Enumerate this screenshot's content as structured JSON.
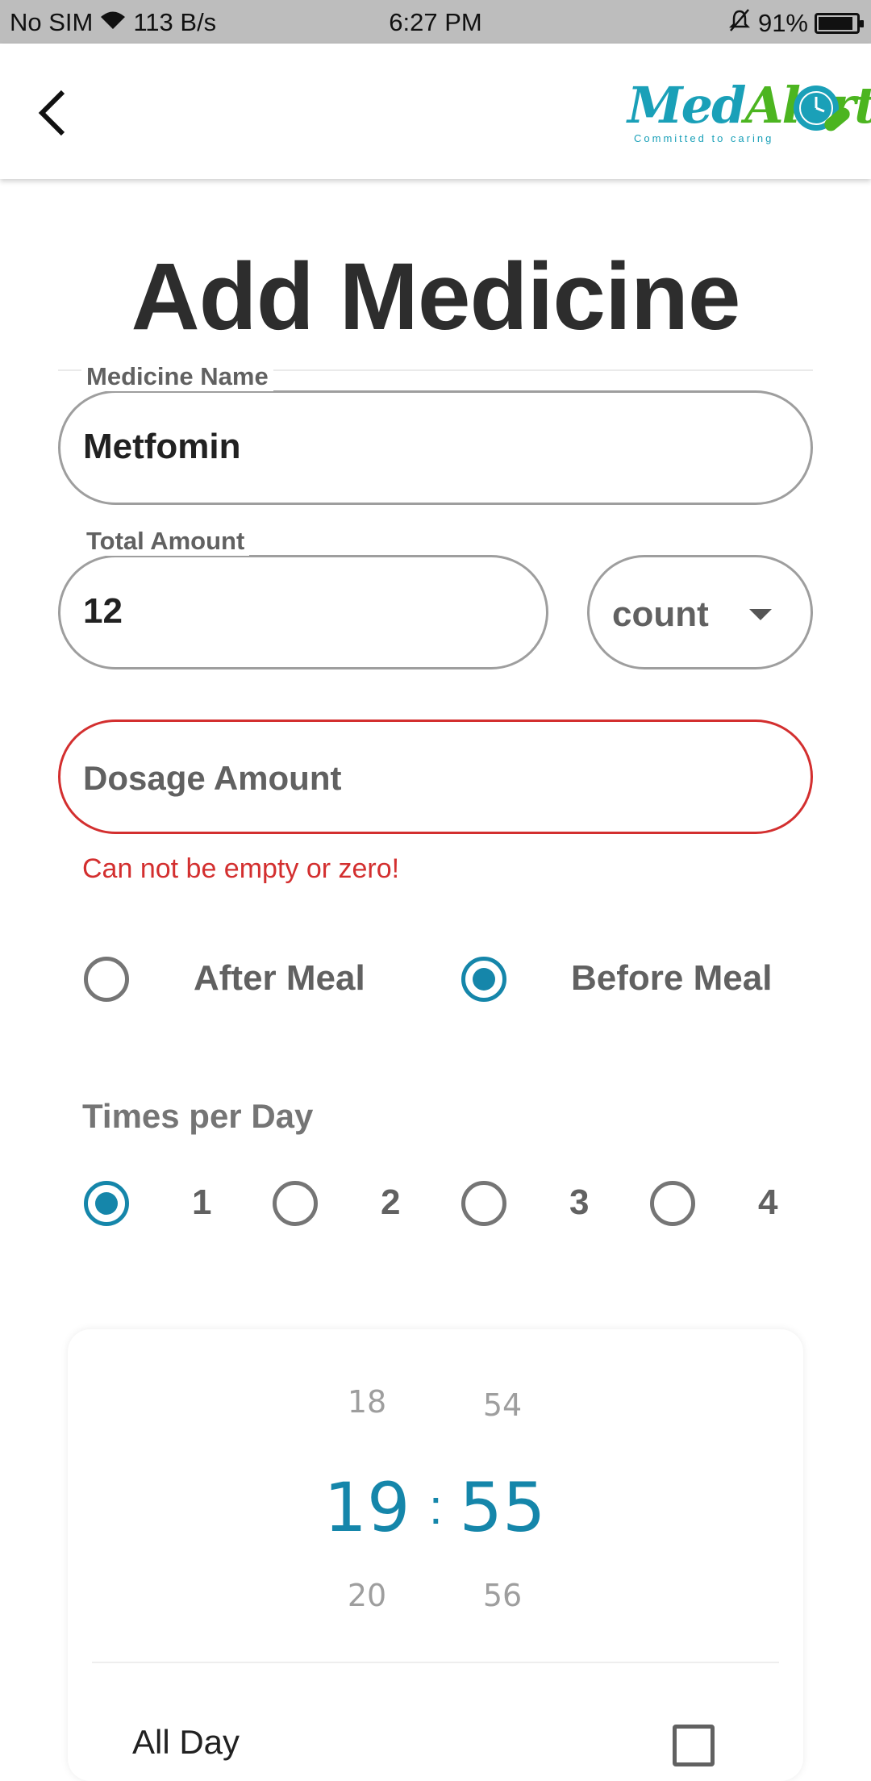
{
  "status_bar": {
    "carrier": "No SIM",
    "speed": "113 B/s",
    "time": "6:27 PM",
    "battery": "91%",
    "battery_level": 0.91
  },
  "app_bar": {
    "logo_text_1": "Med",
    "logo_text_2": "Alert",
    "logo_tagline": "Committed to caring"
  },
  "page": {
    "title": "Add Medicine"
  },
  "form": {
    "medicine_name": {
      "label": "Medicine Name",
      "value": "Metfomin"
    },
    "total_amount": {
      "label": "Total Amount",
      "value": "12"
    },
    "unit_dropdown": {
      "selected": "count"
    },
    "dosage_amount": {
      "placeholder": "Dosage Amount",
      "error": "Can not be empty or zero!"
    },
    "meal_options": [
      {
        "label": "After Meal",
        "checked": false
      },
      {
        "label": "Before Meal",
        "checked": true
      }
    ],
    "times_per_day": {
      "label": "Times per Day",
      "options": [
        {
          "label": "1",
          "checked": true
        },
        {
          "label": "2",
          "checked": false
        },
        {
          "label": "3",
          "checked": false
        },
        {
          "label": "4",
          "checked": false
        }
      ]
    }
  },
  "time_picker": {
    "hour_prev": "18",
    "hour": "19",
    "hour_next": "20",
    "separator": ":",
    "minute_prev": "54",
    "minute": "55",
    "minute_next": "56",
    "all_day_label": "All Day"
  },
  "colors": {
    "accent": "#1586aa",
    "error": "#d32f2f",
    "logo_blue": "#1aa0b8",
    "logo_green": "#4cb520"
  }
}
